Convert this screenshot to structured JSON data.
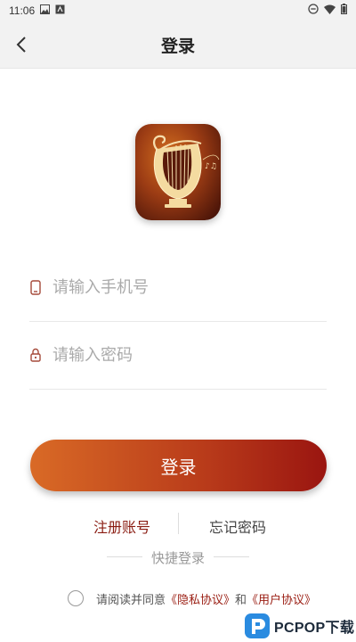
{
  "status_bar": {
    "time": "11:06"
  },
  "header": {
    "title": "登录"
  },
  "form": {
    "phone": {
      "placeholder": "请输入手机号",
      "value": ""
    },
    "password": {
      "placeholder": "请输入密码",
      "value": ""
    },
    "login_label": "登录"
  },
  "links": {
    "register": "注册账号",
    "forgot": "忘记密码"
  },
  "quick_login": {
    "label": "快捷登录"
  },
  "agreement": {
    "prefix": "请阅读并同意",
    "privacy": "《隐私协议》",
    "and": "和",
    "user": "《用户协议》",
    "checked": false
  },
  "watermark": {
    "text": "PCPOP下载"
  },
  "colors": {
    "accent_start": "#d96a26",
    "accent_end": "#9a1510",
    "link": "#8a1c12"
  },
  "icons": [
    "image-icon",
    "android-icon",
    "dnd-icon",
    "wifi-icon",
    "battery-icon",
    "back-arrow-icon",
    "phone-icon",
    "lock-icon",
    "harp-logo"
  ]
}
